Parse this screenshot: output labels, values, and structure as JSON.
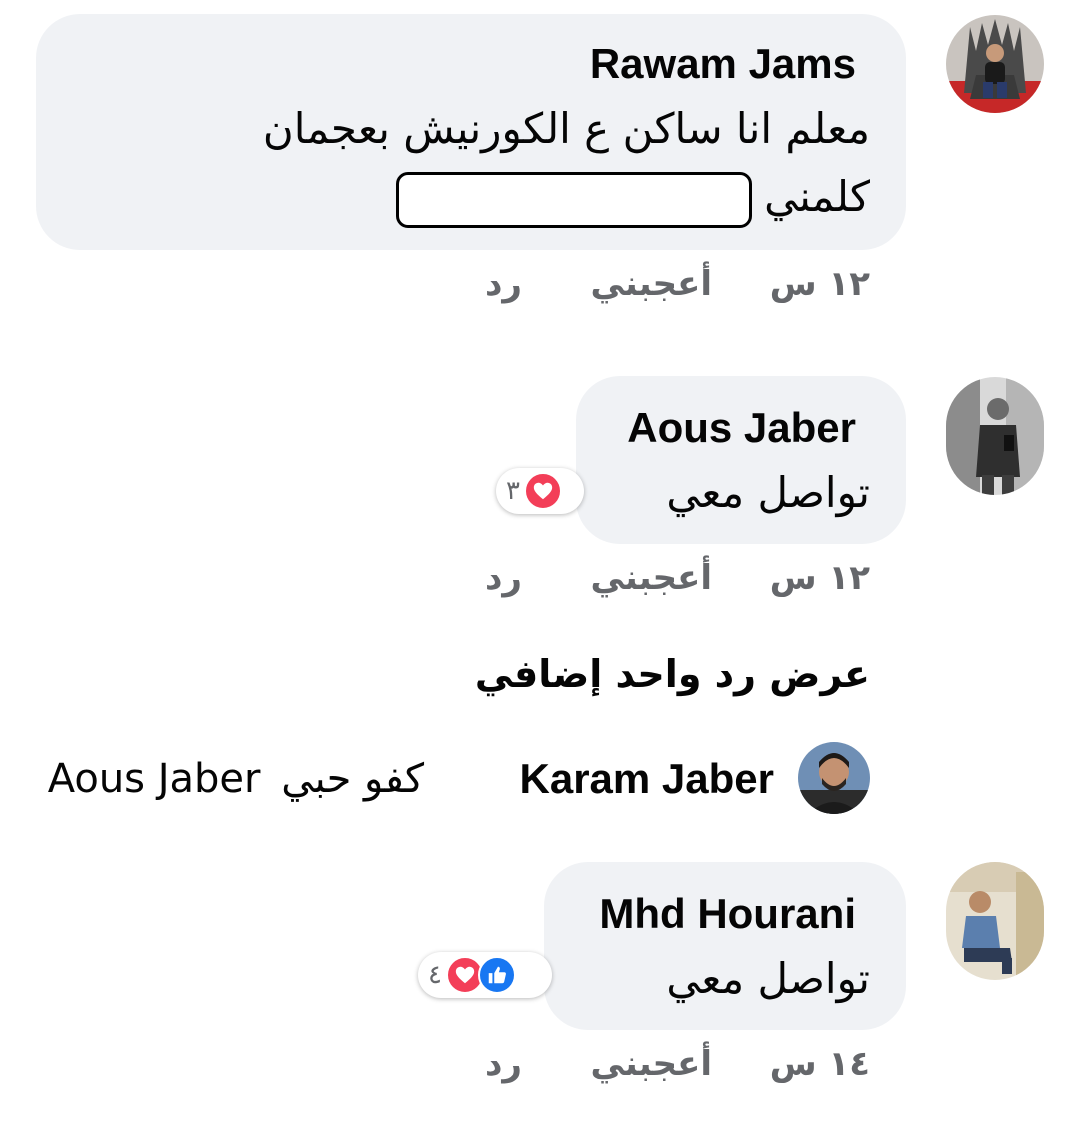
{
  "comments": [
    {
      "author": "Rawam Jams",
      "text_line1": "معلم انا ساكن ع الكورنيش  بعجمان",
      "text_line2": "كلمني",
      "time": "١٢ س",
      "like_label": "أعجبني",
      "reply_label": "رد"
    },
    {
      "author": "Aous Jaber",
      "text": "تواصل معي",
      "reaction_count": "٣",
      "reactions": [
        "love"
      ],
      "time": "١٢ س",
      "like_label": "أعجبني",
      "reply_label": "رد"
    },
    {
      "author": "Mhd Hourani",
      "text": "تواصل معي",
      "reaction_count": "٤",
      "reactions": [
        "like",
        "love"
      ],
      "time": "١٤ س",
      "like_label": "أعجبني",
      "reply_label": "رد"
    }
  ],
  "view_more_replies": "عرض رد واحد إضافي",
  "reply_preview": {
    "author": "Karam Jaber",
    "text": "كفو حبي",
    "mention": "Aous Jaber"
  },
  "colors": {
    "bubble": "#f0f2f5",
    "meta_gray": "#65676b",
    "like_blue": "#1877f2",
    "love_red": "#f33e58"
  }
}
